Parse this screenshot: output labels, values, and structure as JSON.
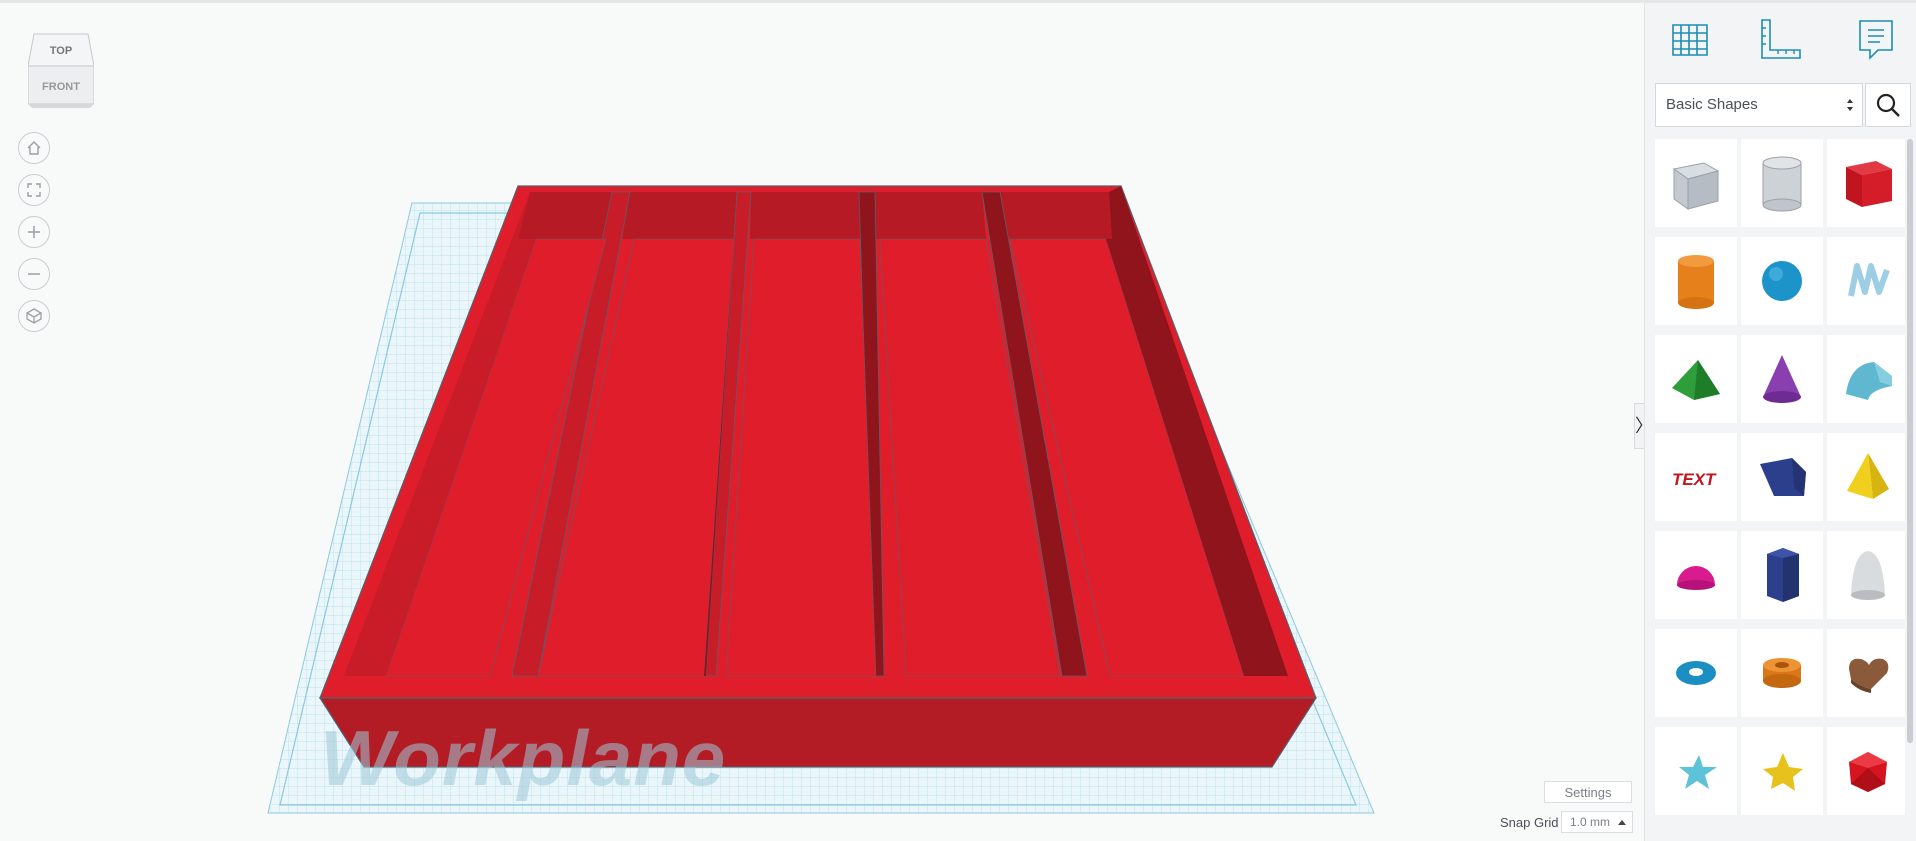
{
  "viewcube": {
    "top_label": "TOP",
    "front_label": "FRONT"
  },
  "nav_icons": [
    "home-icon",
    "fit-view-icon",
    "zoom-in-icon",
    "zoom-out-icon",
    "perspective-icon"
  ],
  "workplane_label": "Workplane",
  "settings_label": "Settings",
  "snap_grid": {
    "label": "Snap Grid",
    "value": "1.0 mm"
  },
  "panel": {
    "tools": [
      "workplane-grid-icon",
      "ruler-icon",
      "notes-icon"
    ],
    "library_select": "Basic Shapes",
    "search_icon": "search-icon",
    "shapes": [
      "box-hole",
      "cylinder-hole",
      "box",
      "cylinder",
      "sphere",
      "scribble",
      "roof",
      "cone",
      "round-roof",
      "text",
      "wedge",
      "pyramid",
      "half-sphere",
      "polygon",
      "paraboloid",
      "torus",
      "tube",
      "heart",
      "star",
      "star-yellow",
      "icosahedron"
    ]
  },
  "colors": {
    "accent": "#1d8eb4",
    "object_red": "#e01e2b",
    "object_dark": "#b11a24",
    "grid": "#a8dbe8"
  }
}
